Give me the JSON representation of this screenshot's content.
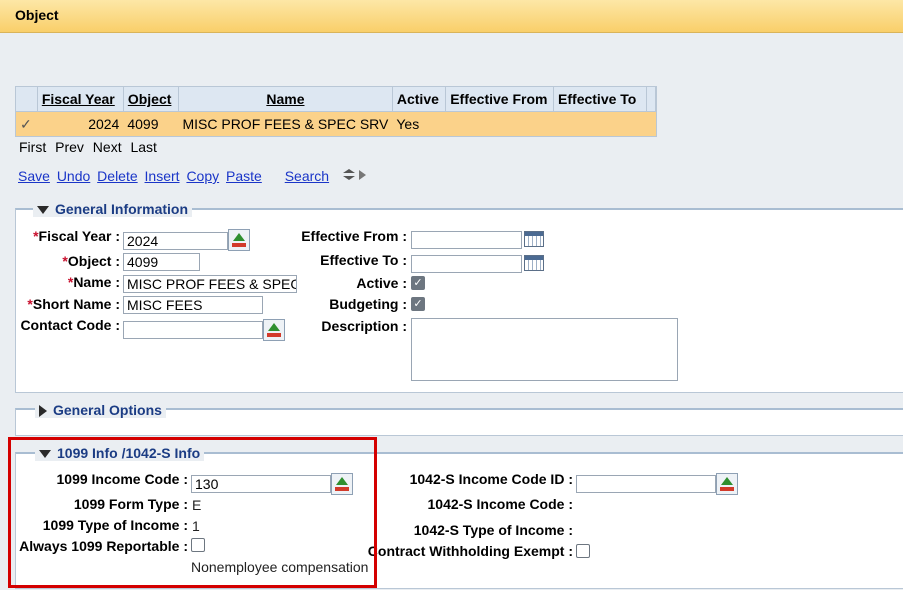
{
  "window": {
    "title": "Object"
  },
  "grid": {
    "headers": [
      "Fiscal Year",
      "Object",
      "Name",
      "Active",
      "Effective From",
      "Effective To"
    ],
    "row": {
      "check": "✓",
      "fiscal_year": "2024",
      "object": "4099",
      "name": "MISC PROF FEES & SPEC SRV",
      "active": "Yes",
      "effective_from": "",
      "effective_to": ""
    },
    "nav": [
      "First",
      "Prev",
      "Next",
      "Last"
    ]
  },
  "toolbar": {
    "save": "Save",
    "undo": "Undo",
    "delete": "Delete",
    "insert": "Insert",
    "copy": "Copy",
    "paste": "Paste",
    "search": "Search"
  },
  "general_info": {
    "title": "General Information",
    "fiscal_year_label": "Fiscal Year :",
    "fiscal_year": "2024",
    "object_label": "Object :",
    "object": "4099",
    "name_label": "Name :",
    "name": "MISC PROF FEES & SPEC",
    "short_name_label": "Short Name :",
    "short_name": "MISC FEES",
    "contact_code_label": "Contact Code :",
    "contact_code": "",
    "effective_from_label": "Effective From :",
    "effective_to_label": "Effective To :",
    "active_label": "Active :",
    "active": true,
    "budgeting_label": "Budgeting :",
    "budgeting": true,
    "description_label": "Description :",
    "description": "",
    "required_mark": "*"
  },
  "general_options": {
    "title": "General Options"
  },
  "info_1099": {
    "title": "1099 Info /1042-S Info",
    "income_code_label": "1099 Income Code :",
    "income_code": "130",
    "form_type_label": "1099 Form Type :",
    "form_type": "E",
    "type_of_income_label": "1099 Type of Income :",
    "type_of_income": "1",
    "always_reportable_label": "Always 1099 Reportable :",
    "always_reportable": false,
    "description_text": "Nonemployee compensation",
    "income_code_id_1042s_label": "1042-S Income Code ID :",
    "income_code_id_1042s": "",
    "income_code_1042s_label": "1042-S Income Code :",
    "type_of_income_1042s_label": "1042-S Type of Income :",
    "contract_withholding_label": "Contract Withholding Exempt :",
    "contract_withholding": false
  }
}
